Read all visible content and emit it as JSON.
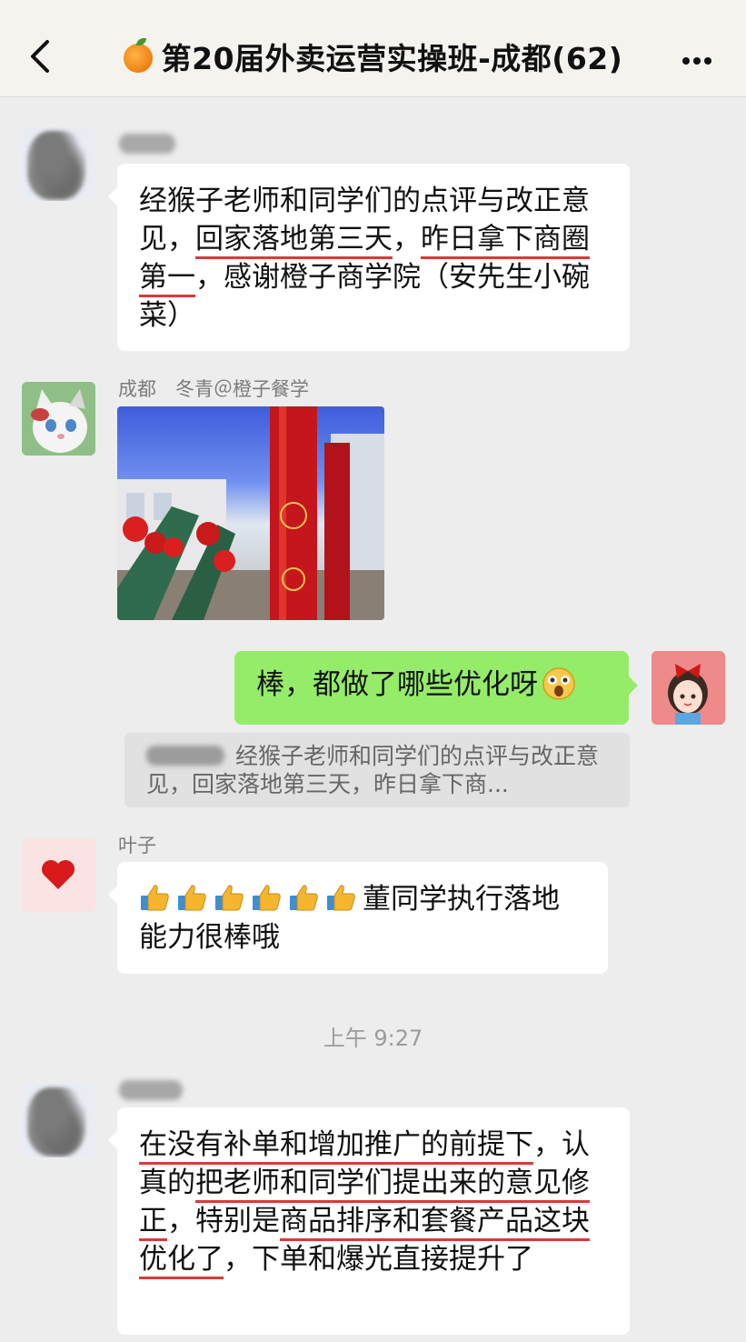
{
  "header": {
    "title": "第20届外卖运营实操班-成都(62)",
    "back_icon": "chevron-left-icon",
    "more_icon": "more-dots-icon"
  },
  "messages": [
    {
      "sender": "",
      "avatar": "blurred-avatar",
      "segments": [
        {
          "text": "经猴子老师和同学们的点评与改正意见，",
          "u": false
        },
        {
          "text": "回家落地第三天",
          "u": true
        },
        {
          "text": "，",
          "u": false
        },
        {
          "text": "昨日拿下商圈第一",
          "u": true
        },
        {
          "text": "，感谢橙子商学院（安先生小碗菜）",
          "u": false
        }
      ]
    },
    {
      "sender": "成都　冬青＠橙子餐学",
      "avatar": "cat-avatar",
      "image": "photo-red-lanterns"
    },
    {
      "sender": "",
      "self": true,
      "avatar": "girl-avatar",
      "text": "棒，都做了哪些优化呀",
      "emoji": "astonished-face-icon",
      "quote": "经猴子老师和同学们的点评与改正意见，回家落地第三天，昨日拿下商..."
    },
    {
      "sender": "叶子",
      "avatar": "heart-avatar",
      "thumbs": 6,
      "text": "董同学执行落地能力很棒哦"
    }
  ],
  "timestamp": "上午 9:27",
  "last_message": {
    "sender": "",
    "avatar": "blurred-avatar",
    "segments": [
      {
        "text": "在没有补单和增加推广的前提下",
        "u": true
      },
      {
        "text": "，认真的",
        "u": false
      },
      {
        "text": "把老师和同学们提出来的意见修正",
        "u": true
      },
      {
        "text": "，特别是",
        "u": false
      },
      {
        "text": "商品排序和套餐产品这块优化了",
        "u": true
      },
      {
        "text": "，下单和爆光直接提升了",
        "u": false
      }
    ]
  },
  "colors": {
    "header_bg": "#f5f3ee",
    "chat_bg": "#ededed",
    "self_bubble": "#95ec69",
    "underline": "#d93a3a"
  }
}
